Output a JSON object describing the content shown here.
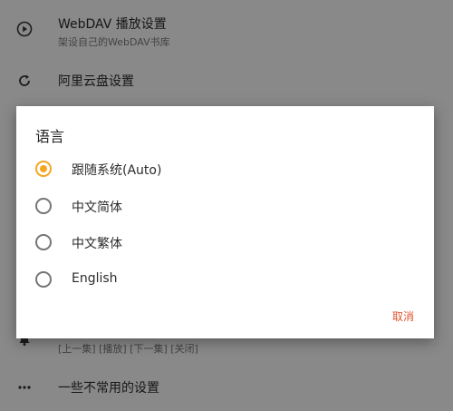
{
  "settings": {
    "webdav": {
      "title": "WebDAV 播放设置",
      "subtitle": "架设自己的WebDAV书库",
      "icon": "play-circle-icon"
    },
    "aliyun": {
      "title": "阿里云盘设置",
      "icon": "refresh-icon"
    },
    "notification": {
      "subtitle": "[上一集] [播放] [下一集] [关闭]",
      "icon": "bell-icon"
    },
    "misc": {
      "title": "一些不常用的设置",
      "icon": "more-horizontal-icon"
    }
  },
  "dialog": {
    "title": "语言",
    "options": [
      {
        "label": "跟随系统(Auto)",
        "selected": true
      },
      {
        "label": "中文简体",
        "selected": false
      },
      {
        "label": "中文繁体",
        "selected": false
      },
      {
        "label": "English",
        "selected": false
      }
    ],
    "cancel_label": "取消"
  },
  "colors": {
    "accent": "#f5a623",
    "cancel": "#e0522f"
  }
}
